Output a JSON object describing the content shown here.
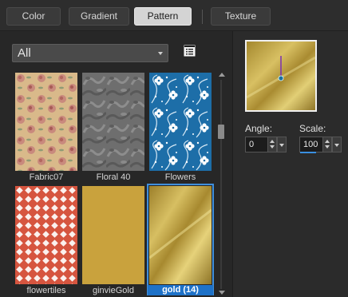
{
  "tabs": [
    {
      "label": "Color",
      "active": false
    },
    {
      "label": "Gradient",
      "active": false
    },
    {
      "label": "Pattern",
      "active": true
    },
    {
      "label": "Texture",
      "active": false
    }
  ],
  "category_dropdown": {
    "selected": "All"
  },
  "patterns": [
    {
      "name": "Fabric07",
      "selected": false
    },
    {
      "name": "Floral 40",
      "selected": false
    },
    {
      "name": "Flowers",
      "selected": false
    },
    {
      "name": "flowertiles",
      "selected": false
    },
    {
      "name": "ginvieGold",
      "selected": false
    },
    {
      "name": "gold (14)",
      "selected": true
    }
  ],
  "angle": {
    "label": "Angle:",
    "value": "0"
  },
  "scale": {
    "label": "Scale:",
    "value": "100"
  },
  "colors": {
    "accent": "#1e72c8",
    "gold": "#c9a545"
  }
}
